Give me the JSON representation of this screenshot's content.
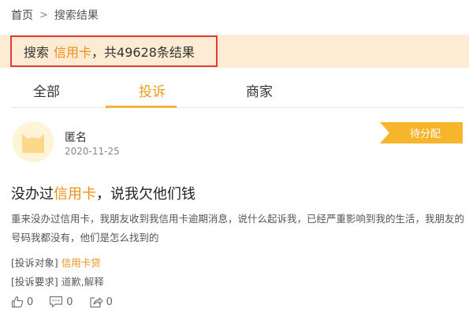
{
  "breadcrumb": {
    "home": "首页",
    "separator": ">",
    "current": "搜索结果"
  },
  "search": {
    "prefix": "搜索",
    "keyword": "信用卡",
    "suffix": "，共49628条结果"
  },
  "tabs": [
    {
      "label": "全部",
      "active": false
    },
    {
      "label": "投诉",
      "active": true
    },
    {
      "label": "商家",
      "active": false
    }
  ],
  "post": {
    "author": "匿名",
    "date": "2020-11-25",
    "status": "待分配",
    "title_pre": "没办过",
    "title_keyword": "信用卡",
    "title_post": "，说我欠他们钱",
    "content": "重来没办过信用卡，我朋友收到我信用卡逾期消息，说什么起诉我，已经严重影响到我的生活，我朋友的号码我都没有，他们是怎么找到的",
    "target_label": "[投诉对象]",
    "target_value": "信用卡贷",
    "request_label": "[投诉要求]",
    "request_value": "道歉,解释",
    "likes": "0",
    "comments": "0",
    "shares": "0"
  },
  "colors": {
    "accent": "#ee8f16",
    "banner": "#fdebd3",
    "tag": "#f7b52c",
    "highlight_border": "#e03a3a"
  },
  "icons": [
    "cat-avatar-icon",
    "thumbs-up-icon",
    "comment-icon",
    "share-icon"
  ]
}
